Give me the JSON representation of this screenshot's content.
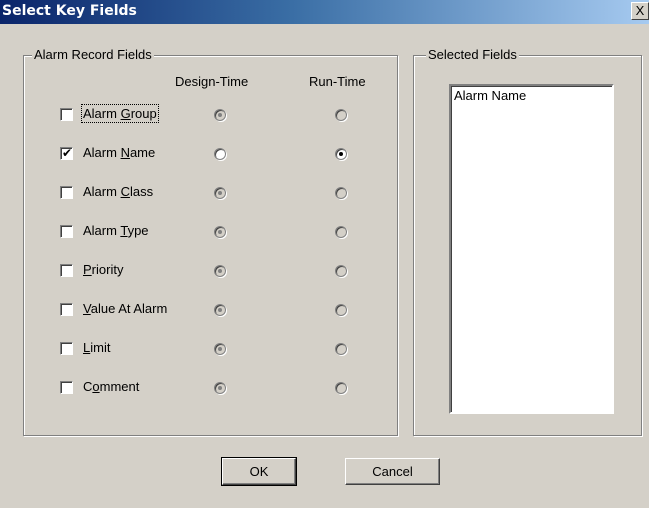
{
  "window": {
    "title": "Select Key Fields",
    "close_label": "X"
  },
  "alarm_group": {
    "legend": "Alarm Record Fields",
    "col_design": "Design-Time",
    "col_run": "Run-Time",
    "rows": [
      {
        "pre": "Alarm ",
        "key": "G",
        "post": "roup",
        "checked": false,
        "design_selected": true,
        "run_selected": false,
        "enabled_radios": false
      },
      {
        "pre": "Alarm ",
        "key": "N",
        "post": "ame",
        "checked": true,
        "design_selected": false,
        "run_selected": true,
        "enabled_radios": true
      },
      {
        "pre": "Alarm ",
        "key": "C",
        "post": "lass",
        "checked": false,
        "design_selected": true,
        "run_selected": false,
        "enabled_radios": false
      },
      {
        "pre": "Alarm ",
        "key": "T",
        "post": "ype",
        "checked": false,
        "design_selected": true,
        "run_selected": false,
        "enabled_radios": false
      },
      {
        "pre": "",
        "key": "P",
        "post": "riority",
        "checked": false,
        "design_selected": true,
        "run_selected": false,
        "enabled_radios": false
      },
      {
        "pre": "",
        "key": "V",
        "post": "alue At Alarm",
        "checked": false,
        "design_selected": true,
        "run_selected": false,
        "enabled_radios": false
      },
      {
        "pre": "",
        "key": "L",
        "post": "imit",
        "checked": false,
        "design_selected": true,
        "run_selected": false,
        "enabled_radios": false
      },
      {
        "pre": "C",
        "key": "o",
        "post": "mment",
        "checked": false,
        "design_selected": true,
        "run_selected": false,
        "enabled_radios": false
      }
    ]
  },
  "selected_group": {
    "legend": "Selected Fields",
    "items": [
      "Alarm Name"
    ]
  },
  "buttons": {
    "ok": "OK",
    "cancel": "Cancel"
  }
}
